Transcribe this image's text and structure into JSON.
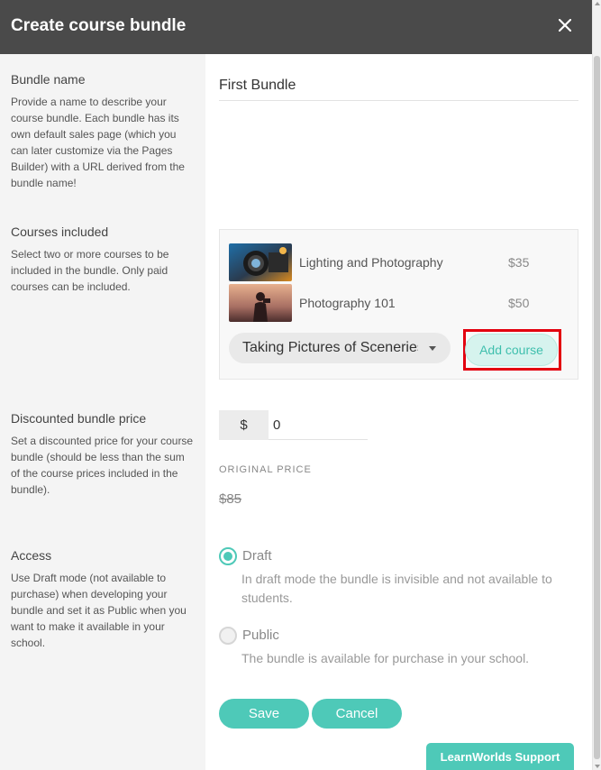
{
  "dialog": {
    "title": "Create course bundle",
    "close_icon": "close-icon"
  },
  "bundle_name": {
    "title": "Bundle name",
    "description": "Provide a name to describe your course bundle. Each bundle has its own default sales page (which you can later customize via the Pages Builder) with a URL derived from the bundle name!",
    "value": "First Bundle"
  },
  "courses_included": {
    "title": "Courses included",
    "description": "Select two or more courses to be included in the bundle. Only paid courses can be included.",
    "courses": [
      {
        "name": "Lighting and Photography",
        "price": "$35",
        "thumb_icon": "camera-lens-thumbnail"
      },
      {
        "name": "Photography 101",
        "price": "$50",
        "thumb_icon": "photographer-silhouette-thumbnail"
      }
    ],
    "select_value": "Taking Pictures of Sceneries",
    "add_button": "Add course"
  },
  "discounted_price": {
    "title": "Discounted bundle price",
    "description": "Set a discounted price for your course bundle (should be less than the sum of the course prices included in the bundle).",
    "currency": "$",
    "value": "0",
    "original_label": "ORIGINAL PRICE",
    "original_value": "$85"
  },
  "access": {
    "title": "Access",
    "description": "Use Draft mode (not available to purchase) when developing your bundle and set it as Public when you want to make it available in your school.",
    "options": [
      {
        "label": "Draft",
        "desc": "In draft mode the bundle is invisible and not available to students.",
        "selected": true
      },
      {
        "label": "Public",
        "desc": "The bundle is available for purchase in your school.",
        "selected": false
      }
    ]
  },
  "actions": {
    "save": "Save",
    "cancel": "Cancel"
  },
  "support": "LearnWorlds Support",
  "colors": {
    "accent": "#4ec9b8",
    "header": "#4a4a4a",
    "highlight": "#e3000f"
  }
}
